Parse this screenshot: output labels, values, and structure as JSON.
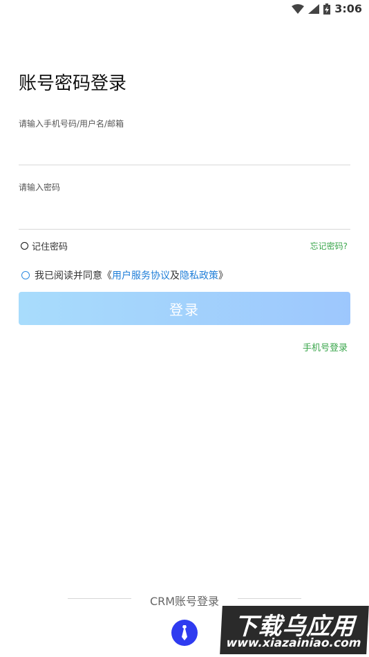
{
  "status_bar": {
    "time": "3:06"
  },
  "page": {
    "title": "账号密码登录"
  },
  "form": {
    "username_label": "请输入手机号码/用户名/邮箱",
    "username_value": "",
    "password_label": "请输入密码",
    "password_value": "",
    "remember_label": "记住密码",
    "forgot_label": "忘记密码?",
    "agree_prefix": "我已阅读并同意《",
    "terms_label": "用户服务协议",
    "agree_and": "及",
    "privacy_label": "隐私政策",
    "agree_suffix": "》",
    "login_button": "登录",
    "phone_login": "手机号登录"
  },
  "footer": {
    "crm_label": "CRM账号登录"
  },
  "watermark": {
    "big": "下载乌应用",
    "small": "www.xiazainiao.com"
  },
  "colors": {
    "accent_green": "#3aa64b",
    "link_blue": "#1f7ed8",
    "crm_blue": "#2f3bf0"
  }
}
